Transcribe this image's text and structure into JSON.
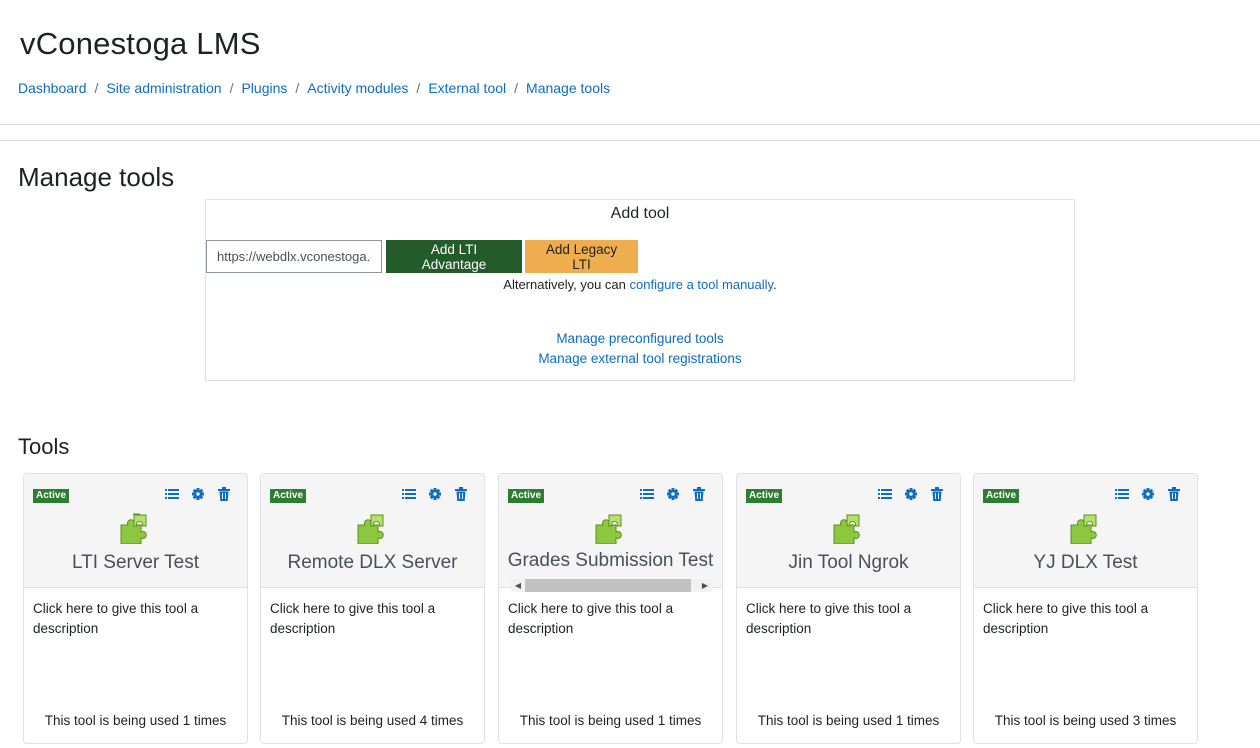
{
  "site": {
    "title": "vConestoga LMS"
  },
  "breadcrumb": {
    "items": [
      "Dashboard",
      "Site administration",
      "Plugins",
      "Activity modules",
      "External tool",
      "Manage tools"
    ],
    "separator": "/"
  },
  "page": {
    "heading": "Manage tools"
  },
  "add_tool": {
    "title": "Add tool",
    "url_value": "https://webdlx.vconestoga.com",
    "btn_advantage": "Add LTI Advantage",
    "btn_legacy": "Add Legacy LTI",
    "alt_prefix": "Alternatively, you can ",
    "alt_link": "configure a tool manually",
    "alt_suffix": ".",
    "link_preconfigured": "Manage preconfigured tools",
    "link_registrations": "Manage external tool registrations"
  },
  "tools": {
    "heading": "Tools",
    "cards": [
      {
        "badge": "Active",
        "name": "LTI Server Test",
        "description": "Click here to give this tool a description",
        "usage": "This tool is being used 1 times"
      },
      {
        "badge": "Active",
        "name": "Remote DLX Server",
        "description": "Click here to give this tool a description",
        "usage": "This tool is being used 4 times"
      },
      {
        "badge": "Active",
        "name": "Grades Submission Test",
        "description": "Click here to give this tool a description",
        "usage": "This tool is being used 1 times"
      },
      {
        "badge": "Active",
        "name": "Jin Tool Ngrok",
        "description": "Click here to give this tool a description",
        "usage": "This tool is being used 1 times"
      },
      {
        "badge": "Active",
        "name": "YJ DLX Test",
        "description": "Click here to give this tool a description",
        "usage": "This tool is being used 3 times"
      }
    ]
  },
  "colors": {
    "link": "#0f6cbf",
    "advantage_button": "#245b2b",
    "legacy_button": "#f0ad4e",
    "active_badge": "#2e7d32",
    "puzzle_icon": "#8dc63f"
  },
  "icons": [
    "list-icon",
    "gear-icon",
    "trash-icon",
    "puzzle-piece-icon"
  ]
}
